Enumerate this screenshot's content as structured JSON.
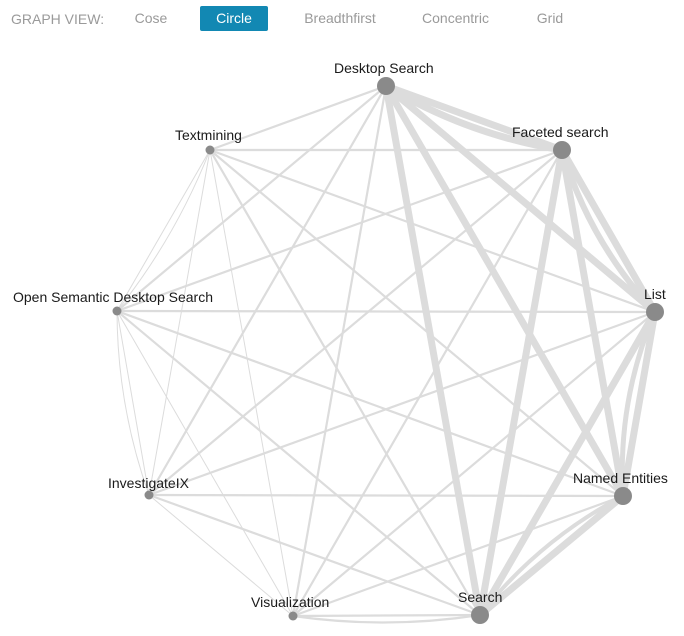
{
  "toolbar": {
    "label": "GRAPH VIEW:",
    "buttons": [
      {
        "label": "Cose",
        "active": false
      },
      {
        "label": "Circle",
        "active": true
      },
      {
        "label": "Breadthfirst",
        "active": false
      },
      {
        "label": "Concentric",
        "active": false
      },
      {
        "label": "Grid",
        "active": false
      }
    ]
  },
  "colors": {
    "edge": "#dcdcdc",
    "node": "#8a8a8a",
    "accent": "#1288b3"
  },
  "graph": {
    "layout": "circle",
    "nodes": [
      {
        "id": "desktop",
        "label": "Desktop Search",
        "weight": 9
      },
      {
        "id": "faceted",
        "label": "Faceted search",
        "weight": 9
      },
      {
        "id": "list",
        "label": "List",
        "weight": 9
      },
      {
        "id": "named",
        "label": "Named Entities",
        "weight": 9
      },
      {
        "id": "search",
        "label": "Search",
        "weight": 9
      },
      {
        "id": "viz",
        "label": "Visualization",
        "weight": 4
      },
      {
        "id": "investigate",
        "label": "InvestigateIX",
        "weight": 4
      },
      {
        "id": "osds",
        "label": "Open Semantic Desktop Search",
        "weight": 4
      },
      {
        "id": "textmining",
        "label": "Textmining",
        "weight": 4
      }
    ]
  }
}
